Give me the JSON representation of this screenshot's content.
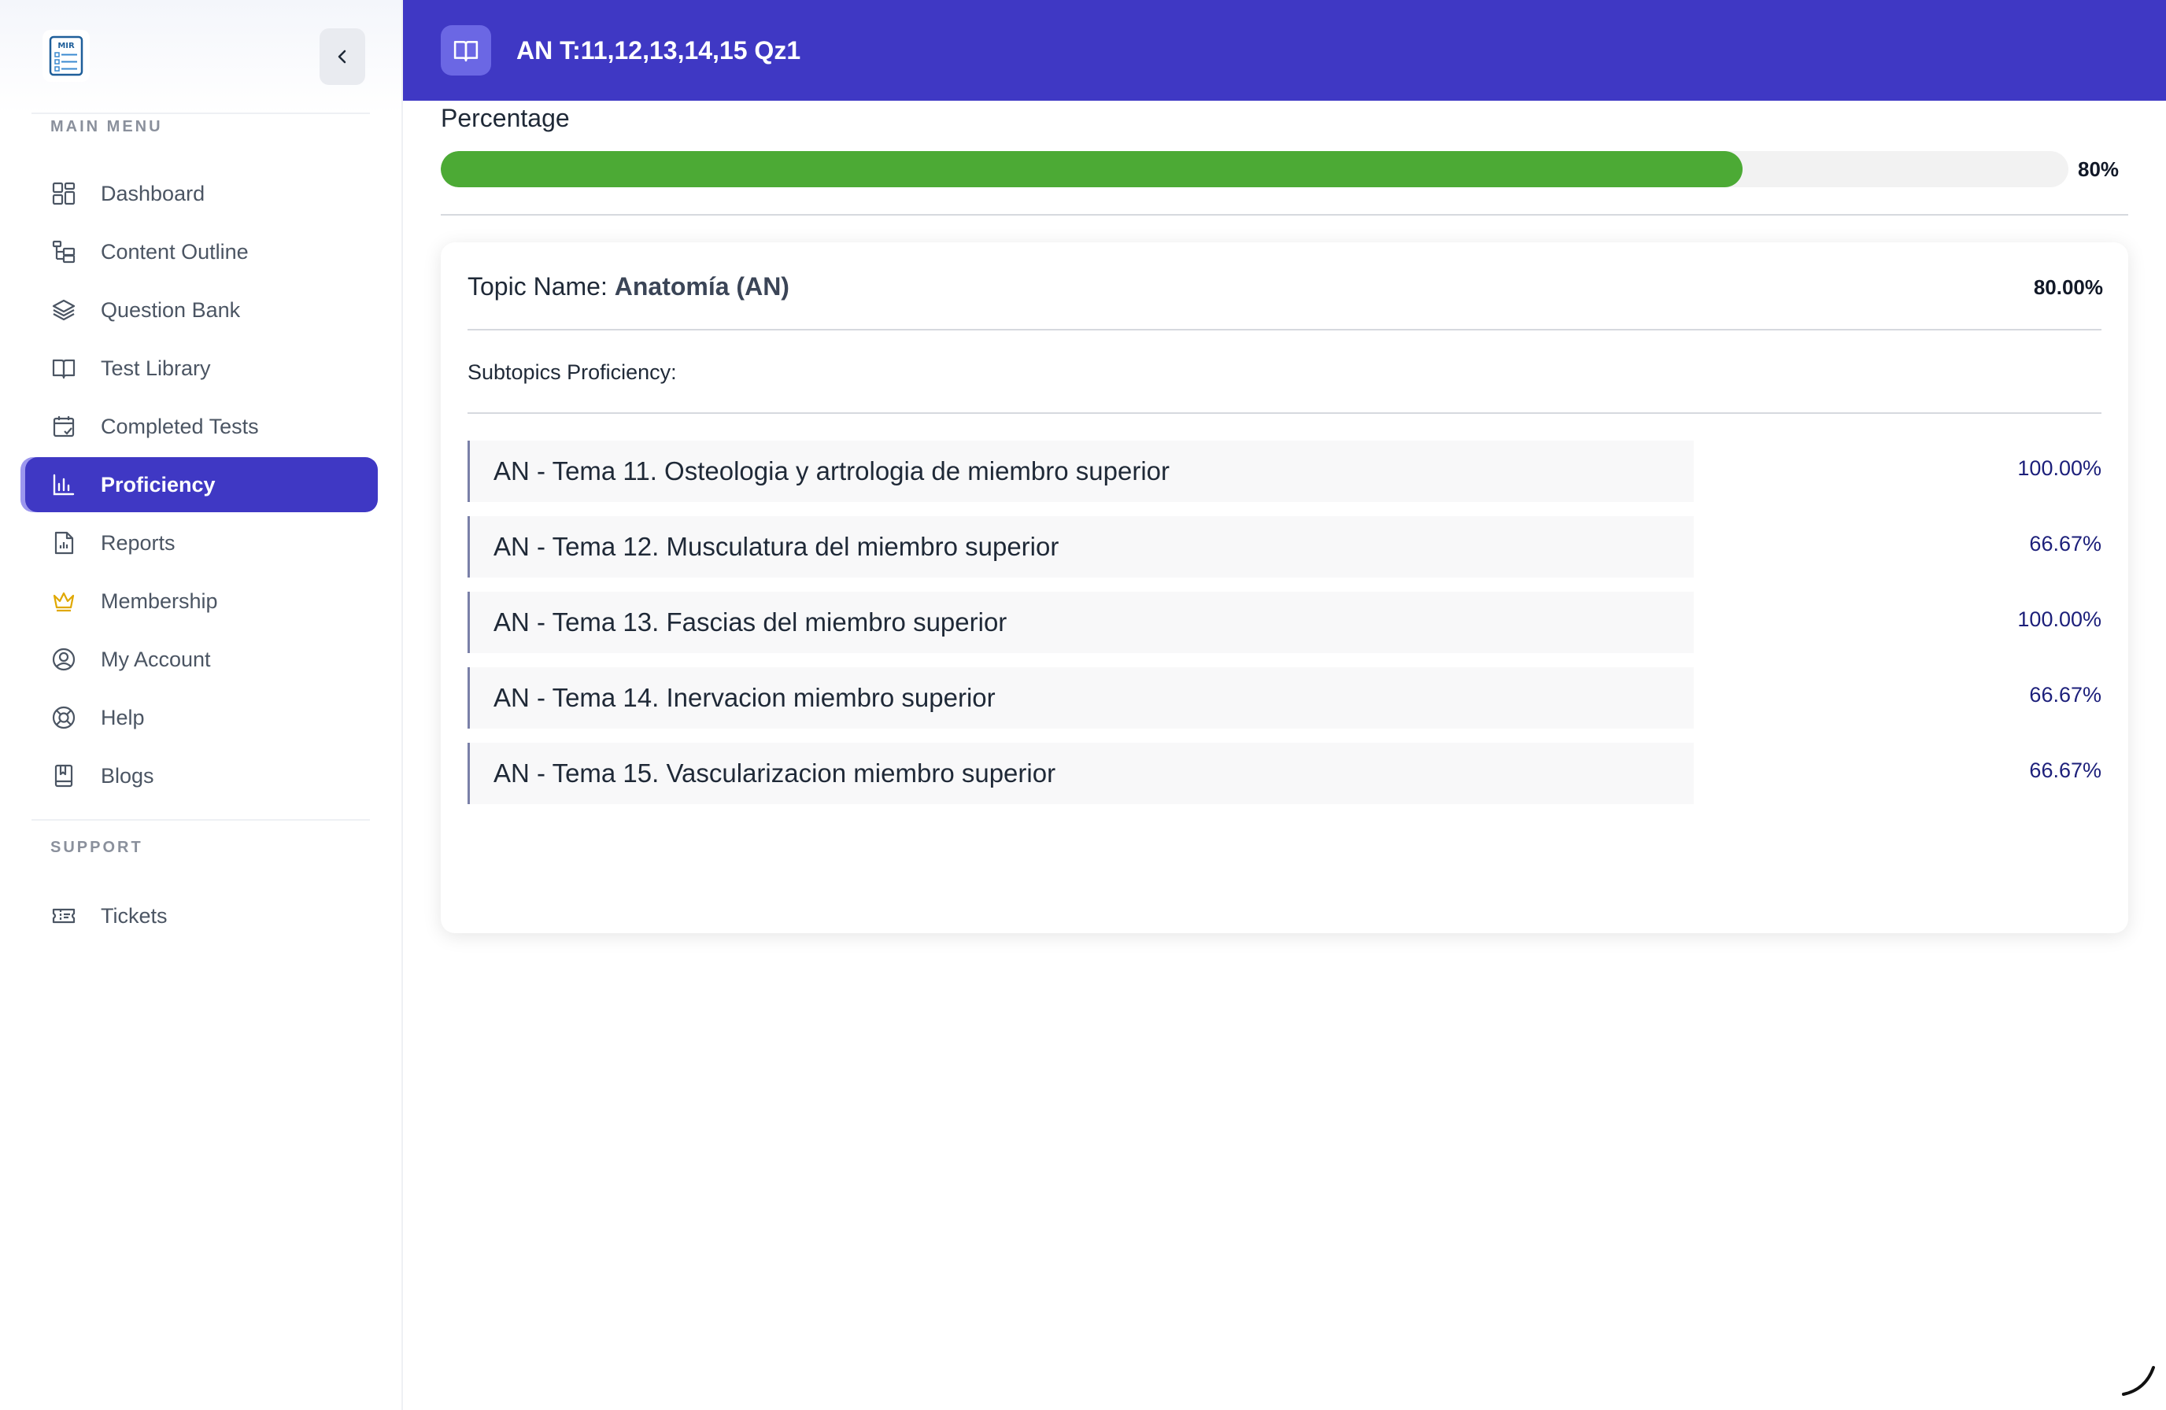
{
  "sidebar": {
    "logo_text": "MIR",
    "main_menu_label": "MAIN MENU",
    "support_label": "SUPPORT",
    "items": [
      {
        "label": "Dashboard",
        "icon": "dashboard-icon"
      },
      {
        "label": "Content Outline",
        "icon": "outline-icon"
      },
      {
        "label": "Question Bank",
        "icon": "layers-icon"
      },
      {
        "label": "Test Library",
        "icon": "book-open-icon"
      },
      {
        "label": "Completed Tests",
        "icon": "calendar-check-icon"
      },
      {
        "label": "Proficiency",
        "icon": "bar-chart-icon",
        "active": true
      },
      {
        "label": "Reports",
        "icon": "report-icon"
      },
      {
        "label": "Membership",
        "icon": "crown-icon"
      },
      {
        "label": "My Account",
        "icon": "user-circle-icon"
      },
      {
        "label": "Help",
        "icon": "lifebuoy-icon"
      },
      {
        "label": "Blogs",
        "icon": "bookmark-book-icon"
      }
    ],
    "support_items": [
      {
        "label": "Tickets",
        "icon": "ticket-icon"
      }
    ]
  },
  "header": {
    "title": "AN T:11,12,13,14,15 Qz1",
    "icon": "book-open-icon"
  },
  "main": {
    "percentage_label": "Percentage",
    "progress_value": 80,
    "progress_text": "80%",
    "topic": {
      "name_prefix": "Topic Name: ",
      "name": "Anatomía (AN)",
      "score": "80.00%",
      "subtopics_label": "Subtopics Proficiency:",
      "subtopics": [
        {
          "name": "AN - Tema 11. Osteologia y artrologia de miembro superior",
          "score": "100.00%"
        },
        {
          "name": "AN - Tema 12. Musculatura del miembro superior",
          "score": "66.67%"
        },
        {
          "name": "AN - Tema 13. Fascias del miembro superior",
          "score": "100.00%"
        },
        {
          "name": "AN - Tema 14. Inervacion miembro superior",
          "score": "66.67%"
        },
        {
          "name": "AN - Tema 15. Vascularizacion miembro superior",
          "score": "66.67%"
        }
      ]
    }
  },
  "colors": {
    "accent": "#3f38c4",
    "progress": "#4caa35",
    "crown": "#e0a800"
  }
}
